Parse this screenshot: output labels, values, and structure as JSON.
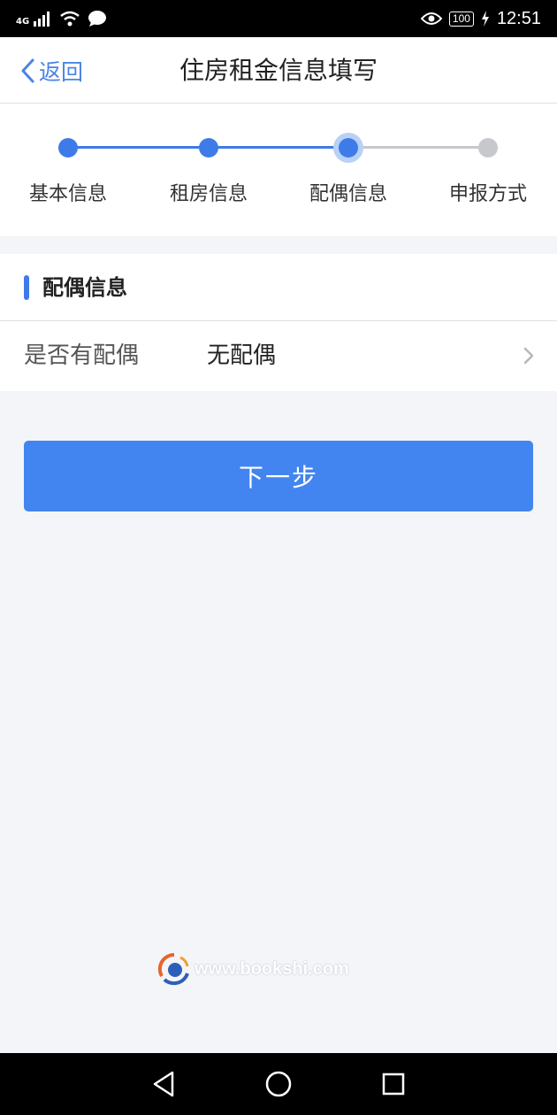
{
  "status_bar": {
    "network_label": "4G",
    "battery": "100",
    "time": "12:51"
  },
  "header": {
    "back_label": "返回",
    "title": "住房租金信息填写"
  },
  "stepper": {
    "steps": [
      {
        "label": "基本信息",
        "state": "done"
      },
      {
        "label": "租房信息",
        "state": "done"
      },
      {
        "label": "配偶信息",
        "state": "current"
      },
      {
        "label": "申报方式",
        "state": "todo"
      }
    ]
  },
  "section": {
    "title": "配偶信息"
  },
  "spouse_row": {
    "label": "是否有配偶",
    "value": "无配偶"
  },
  "next_button": {
    "label": "下一步"
  },
  "watermark": {
    "text": "www.bookshi.com"
  },
  "colors": {
    "accent": "#3f7be8",
    "button": "#4285f0",
    "inactive": "#c6c8cc",
    "background": "#f4f5f9"
  },
  "icons": [
    "back-chevron-icon",
    "chevron-right-icon",
    "signal-icon",
    "wifi-icon",
    "message-icon",
    "eye-icon",
    "charging-icon",
    "nav-back-icon",
    "nav-home-icon",
    "nav-recent-icon"
  ]
}
